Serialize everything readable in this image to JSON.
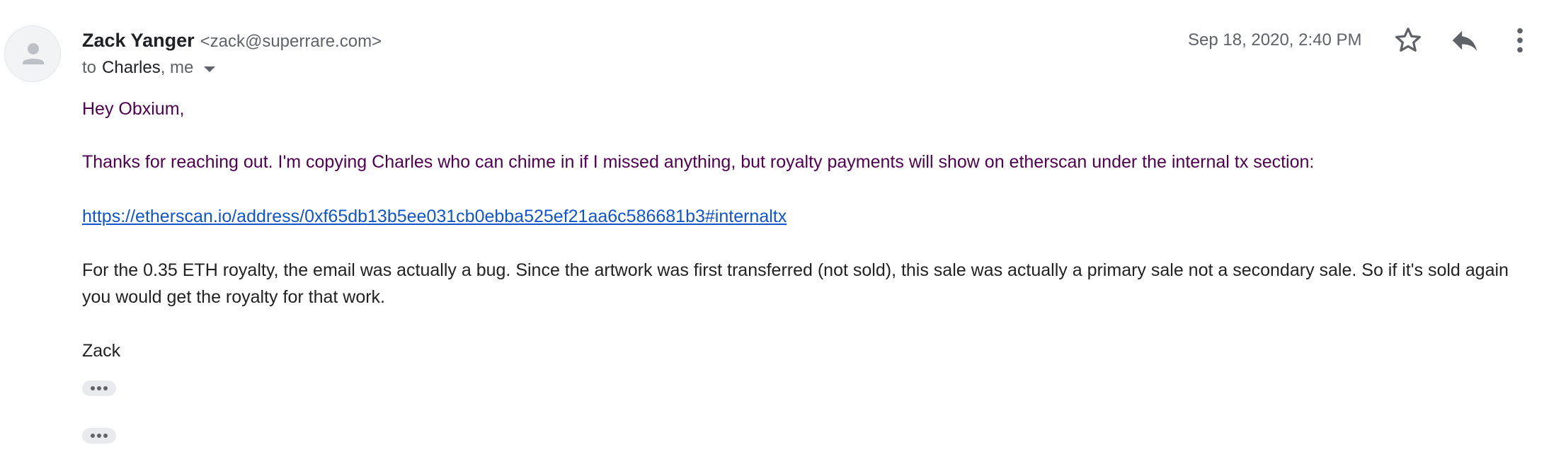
{
  "sender": {
    "name": "Zack Yanger",
    "email": "<zack@superrare.com>"
  },
  "recipients": {
    "to_label": "to",
    "names": "Charles",
    "me": ", me"
  },
  "date": "Sep 18, 2020, 2:40 PM",
  "icons": {
    "avatar": "person-icon",
    "star": "star-icon",
    "reply": "reply-icon",
    "more": "more-vert-icon",
    "details": "caret-down-icon",
    "trimmed": "ellipsis-icon"
  },
  "message": {
    "greeting": "Hey Obxium,",
    "line1": "Thanks for reaching out. I'm copying Charles who can chime in if I missed anything, but royalty payments will show on etherscan under the internal tx section:",
    "link": "https://etherscan.io/address/0xf65db13b5ee031cb0ebba525ef21aa6c586681b3#internaltx",
    "paragraph": "For the 0.35 ETH royalty, the email was actually a bug. Since the artwork was first transferred (not sold), this sale was actually a primary sale not a secondary sale. So if it's sold again you would get the royalty for that work.",
    "signoff": "Zack"
  },
  "colors": {
    "quoted_text": "#500050",
    "link": "#1155cc",
    "secondary_text": "#5f6368"
  }
}
